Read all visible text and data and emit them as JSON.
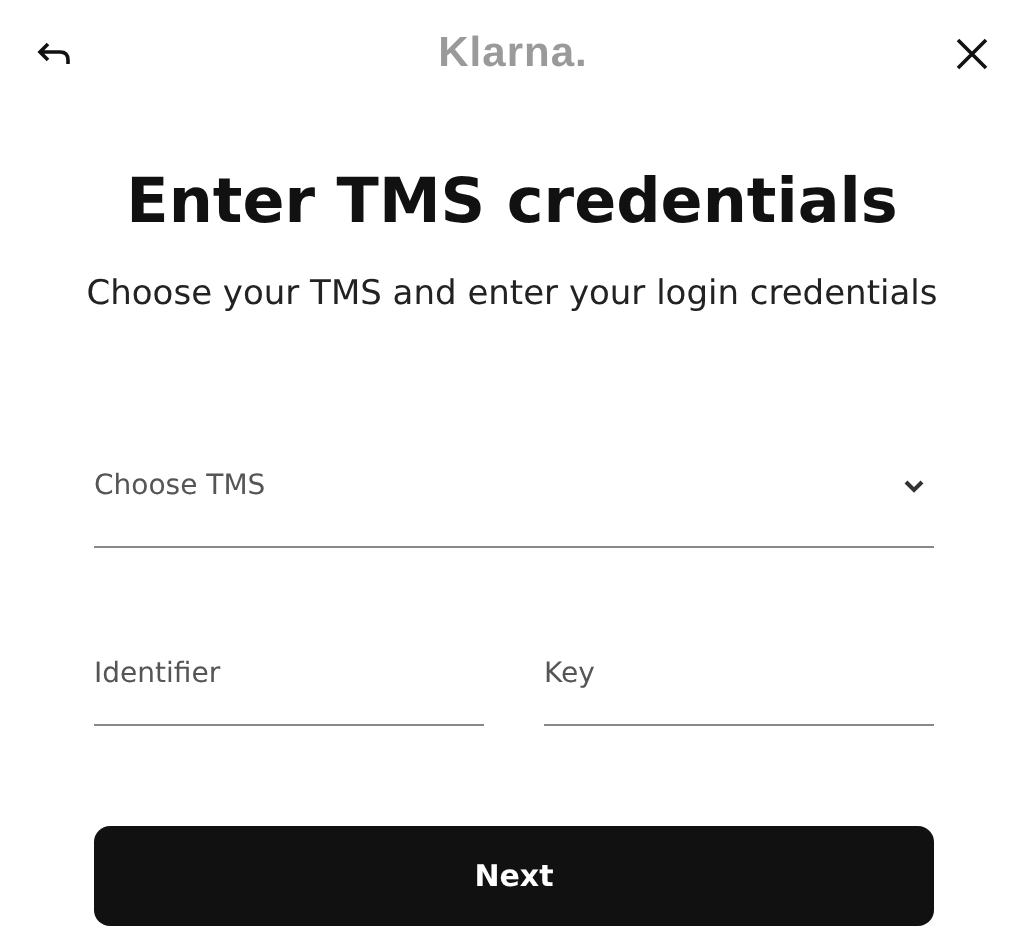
{
  "header": {
    "logo": "Klarna."
  },
  "title": "Enter TMS credentials",
  "subtitle": "Choose your TMS and enter your login credentials",
  "select": {
    "placeholder": "Choose TMS"
  },
  "fields": [
    {
      "placeholder": "Identifier"
    },
    {
      "placeholder": "Key"
    }
  ],
  "button": "Next"
}
